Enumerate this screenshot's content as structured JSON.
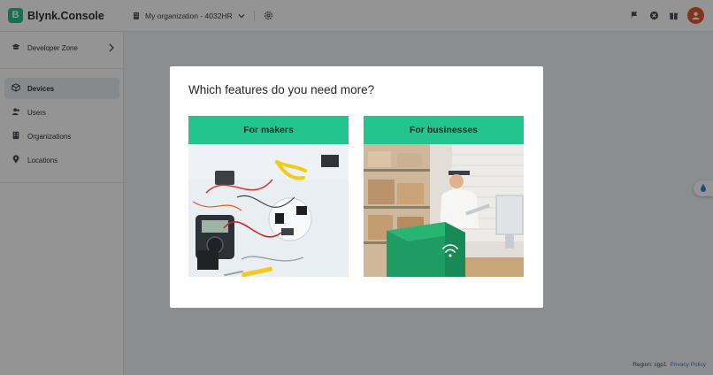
{
  "app": {
    "logo_letter": "B",
    "name": "Blynk.Console"
  },
  "header": {
    "organization": "My organization - 4032HR",
    "icons": [
      "flag-icon",
      "info-icon",
      "gift-icon"
    ],
    "avatar_icon": "user-avatar-icon"
  },
  "sidebar": {
    "items": [
      {
        "label": "Developer Zone",
        "icon": "graduation-cap-icon"
      },
      {
        "label": "Devices",
        "icon": "cube-icon",
        "active": true
      },
      {
        "label": "Users",
        "icon": "users-icon"
      },
      {
        "label": "Organizations",
        "icon": "building-icon"
      },
      {
        "label": "Locations",
        "icon": "map-pin-icon"
      }
    ]
  },
  "footer": {
    "region": "Region: sgp1",
    "privacy": "Privacy Policy"
  },
  "modal": {
    "title": "Which features do you need more?",
    "cards": [
      {
        "label": "For makers",
        "image": "electronics-workbench-photo"
      },
      {
        "label": "For businesses",
        "image": "warehouse-worker-photo"
      }
    ]
  },
  "colors": {
    "accent": "#23c48e",
    "overlay": "rgba(0,0,0,0.42)",
    "link": "#3a7bd5",
    "avatar": "#e4572e"
  }
}
